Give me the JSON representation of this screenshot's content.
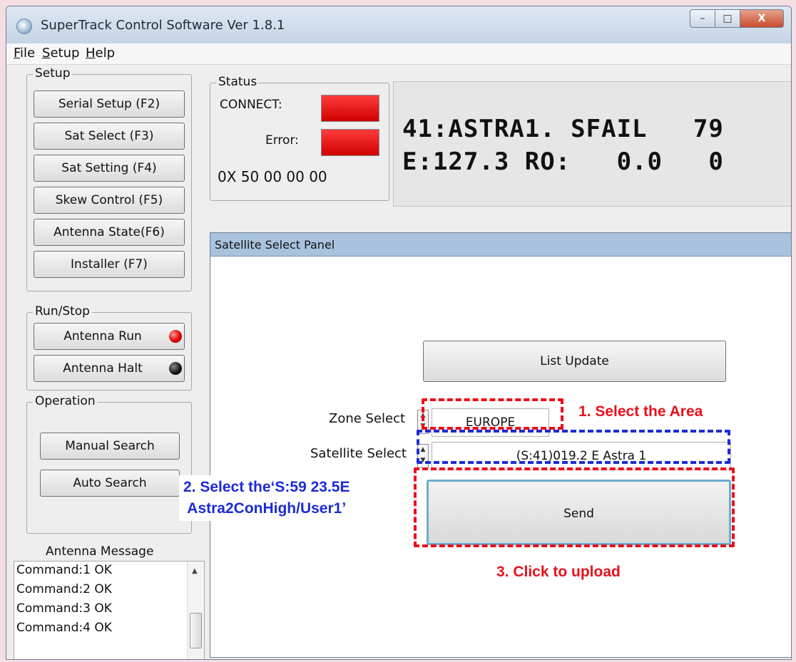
{
  "window": {
    "title": "SuperTrack Control Software Ver 1.8.1",
    "controls": {
      "minimize": "–",
      "maximize": "□",
      "close": "X"
    }
  },
  "menu": [
    "File",
    "Setup",
    "Help"
  ],
  "setup_group": {
    "label": "Setup",
    "buttons": [
      "Serial Setup (F2)",
      "Sat Select  (F3)",
      "Sat Setting  (F4)",
      "Skew Control (F5)",
      "Antenna State(F6)",
      "Installer    (F7)"
    ]
  },
  "runstop_group": {
    "label": "Run/Stop",
    "run_label": "Antenna Run",
    "halt_label": "Antenna Halt"
  },
  "operation_group": {
    "label": "Operation",
    "manual": "Manual Search",
    "auto": "Auto Search"
  },
  "status": {
    "label": "Status",
    "connect_label": "CONNECT:",
    "error_label": "Error:",
    "code": "0X 50 00 00 00"
  },
  "lcd": {
    "line1": "41:ASTRA1. SFAIL   79",
    "line2": "E:127.3 RO:   0.0   0"
  },
  "panel": {
    "title": "Satellite Select Panel",
    "list_update": "List Update",
    "zone_label": "Zone Select",
    "zone_value": "EUROPE",
    "sat_label": "Satellite Select",
    "sat_value": "(S:41)019.2 E  Astra 1",
    "send": "Send"
  },
  "annotations": {
    "a1": "1. Select the Area",
    "a2_line1": "2. Select theʻS:59 23.5E",
    "a2_line2": "Astra2ConHigh/User1ʼ",
    "a3": "3. Click to upload"
  },
  "messages": {
    "label": "Antenna Message",
    "lines": [
      "Command:1 OK",
      "Command:2 OK",
      "Command:3 OK",
      "Command:4 OK"
    ]
  },
  "colors": {
    "annotation_red": "#e8101a",
    "annotation_blue": "#1c2bd6",
    "panel_header": "#a9c3de",
    "led_red": "#e00000"
  }
}
